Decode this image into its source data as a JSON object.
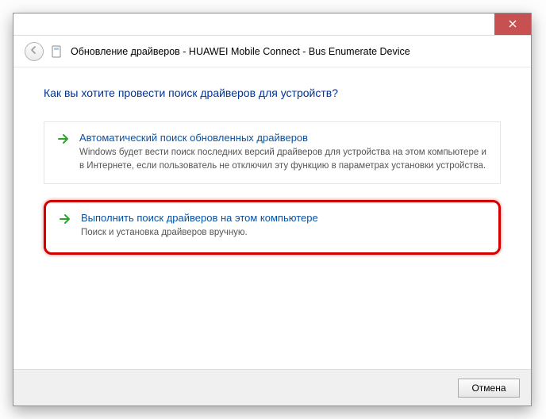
{
  "window": {
    "title": "Обновление драйверов - HUAWEI Mobile Connect - Bus Enumerate Device"
  },
  "heading": "Как вы хотите провести поиск драйверов для устройств?",
  "options": [
    {
      "title": "Автоматический поиск обновленных драйверов",
      "desc": "Windows будет вести поиск последних версий драйверов для устройства на этом компьютере и в Интернете, если пользователь не отключил эту функцию в параметрах установки устройства."
    },
    {
      "title": "Выполнить поиск драйверов на этом компьютере",
      "desc": "Поиск и установка драйверов вручную."
    }
  ],
  "footer": {
    "cancel": "Отмена"
  }
}
